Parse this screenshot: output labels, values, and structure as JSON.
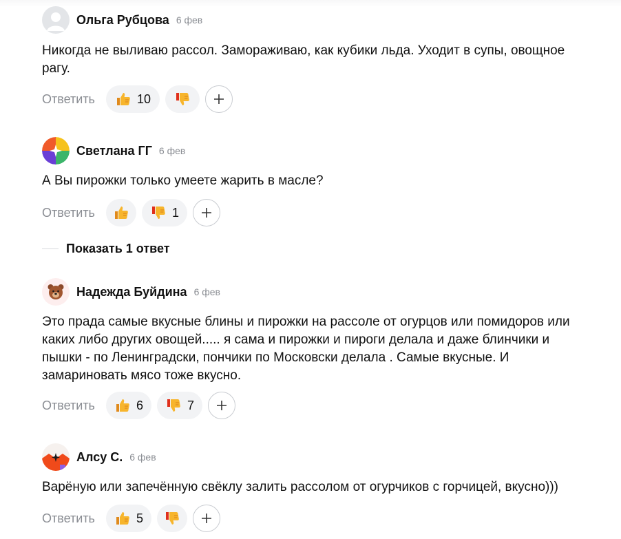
{
  "comments": [
    {
      "author": "Ольга Рубцова",
      "date": "6 фев",
      "text": "Никогда не выливаю рассол. Замораживаю, как кубики льда. Уходит в супы, овощное рагу.",
      "reply_label": "Ответить",
      "likes": "10",
      "dislikes": "",
      "avatar": "default-person-icon"
    },
    {
      "author": "Светлана ГГ",
      "date": "6 фев",
      "text": "А Вы пирожки только умеете жарить в масле?",
      "reply_label": "Ответить",
      "likes": "",
      "dislikes": "1",
      "avatar": "colorful-circle-icon"
    },
    {
      "author": "Надежда Буйдина",
      "date": "6 фев",
      "text": "Это прада самые вкусные блины и пирожки на рассоле от огурцов или помидоров или каких либо других овощей..... я сама и пирожки и пироги делала и даже блинчики и пышки - по Ленинградски, пончики по Московски делала . Самые вкусные. И замариновать мясо тоже вкусно.",
      "reply_label": "Ответить",
      "likes": "6",
      "dislikes": "7",
      "avatar": "bear-emoji-icon"
    },
    {
      "author": "Алсу С.",
      "date": "6 фев",
      "text": "Варёную или запечённую свёклу залить рассолом от огурчиков с горчицей, вкусно)))",
      "reply_label": "Ответить",
      "likes": "5",
      "dislikes": "",
      "avatar": "orange-sparkle-icon"
    }
  ],
  "show_replies": {
    "label": "Показать 1 ответ"
  },
  "colors": {
    "muted": "#8a8d93",
    "pill_bg": "#f2f3f5",
    "thumb": "#f7b52c"
  }
}
